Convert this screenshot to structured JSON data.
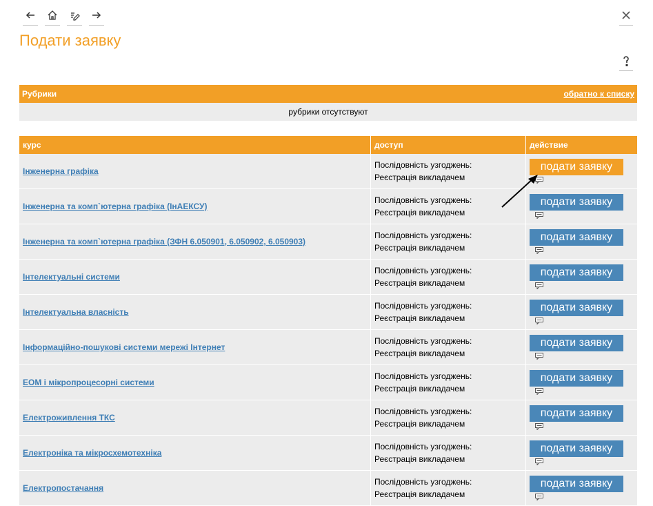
{
  "page": {
    "title": "Подати заявку"
  },
  "toolbar": {
    "icons": [
      "back-arrow-icon",
      "home-icon",
      "edit-icon",
      "forward-arrow-icon"
    ]
  },
  "rubrics": {
    "title": "Рубрики",
    "back_link": "обратно к списку",
    "empty_text": "рубрики отсутствуют"
  },
  "table": {
    "headers": {
      "course": "курс",
      "access": "доступ",
      "action": "действие"
    },
    "rows": [
      {
        "course": "Інженерна графіка",
        "access_line1": "Послідовність узгоджень:",
        "access_line2": "Реєстрація викладачем",
        "button": "подати заявку",
        "hover": true
      },
      {
        "course": "Інженерна та комп`ютерна графіка (ІнАЕКСУ)",
        "access_line1": "Послідовність узгоджень:",
        "access_line2": "Реєстрація викладачем",
        "button": "подати заявку"
      },
      {
        "course": "Інженерна та комп`ютерна графіка (ЗФН 6.050901, 6.050902, 6.050903)",
        "access_line1": "Послідовність узгоджень:",
        "access_line2": "Реєстрація викладачем",
        "button": "подати заявку"
      },
      {
        "course": "Інтелектуальні системи",
        "access_line1": "Послідовність узгоджень:",
        "access_line2": "Реєстрація викладачем",
        "button": "подати заявку"
      },
      {
        "course": "Інтелектуальна власність",
        "access_line1": "Послідовність узгоджень:",
        "access_line2": "Реєстрація викладачем",
        "button": "подати заявку"
      },
      {
        "course": "Інформаційно-пошукові системи мережі Інтернет",
        "access_line1": "Послідовність узгоджень:",
        "access_line2": "Реєстрація викладачем",
        "button": "подати заявку"
      },
      {
        "course": "ЕОМ і мікропроцесорні системи",
        "access_line1": "Послідовність узгоджень:",
        "access_line2": "Реєстрація викладачем",
        "button": "подати заявку"
      },
      {
        "course": "Електроживлення ТКС",
        "access_line1": "Послідовність узгоджень:",
        "access_line2": "Реєстрація викладачем",
        "button": "подати заявку"
      },
      {
        "course": "Електроніка та мікросхемотехніка",
        "access_line1": "Послідовність узгоджень:",
        "access_line2": "Реєстрація викладачем",
        "button": "подати заявку"
      },
      {
        "course": "Електропостачання",
        "access_line1": "Послідовність узгоджень:",
        "access_line2": "Реєстрація викладачем",
        "button": "подати заявку"
      }
    ]
  },
  "colors": {
    "accent": "#f29f26",
    "button": "#4a87b8",
    "link": "#3e7eb5",
    "row_bg": "#ececec"
  }
}
